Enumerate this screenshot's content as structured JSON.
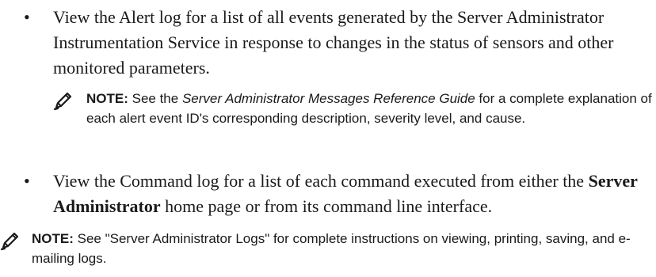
{
  "bullets": [
    {
      "text": "View the Alert log for a list of all events generated by the Server Administrator Instrumentation Service in response to changes in the status of sensors and other monitored parameters."
    },
    {
      "pre": "View the Command log for a list of each command executed from either the ",
      "strong": "Server Administrator",
      "post": " home page or from its command line interface."
    }
  ],
  "notes": [
    {
      "label": "NOTE:",
      "pre": " See the ",
      "italic": "Server Administrator Messages Reference Guide",
      "post": " for a complete explanation of each alert event ID's corresponding description, severity level, and cause."
    },
    {
      "label": "NOTE:",
      "text": " See \"Server Administrator Logs\" for complete instructions on viewing, printing, saving, and e-mailing logs."
    }
  ],
  "icons": {
    "note": "pencil-note-icon",
    "bullet": "bullet-icon"
  },
  "bullet_glyph": "•"
}
